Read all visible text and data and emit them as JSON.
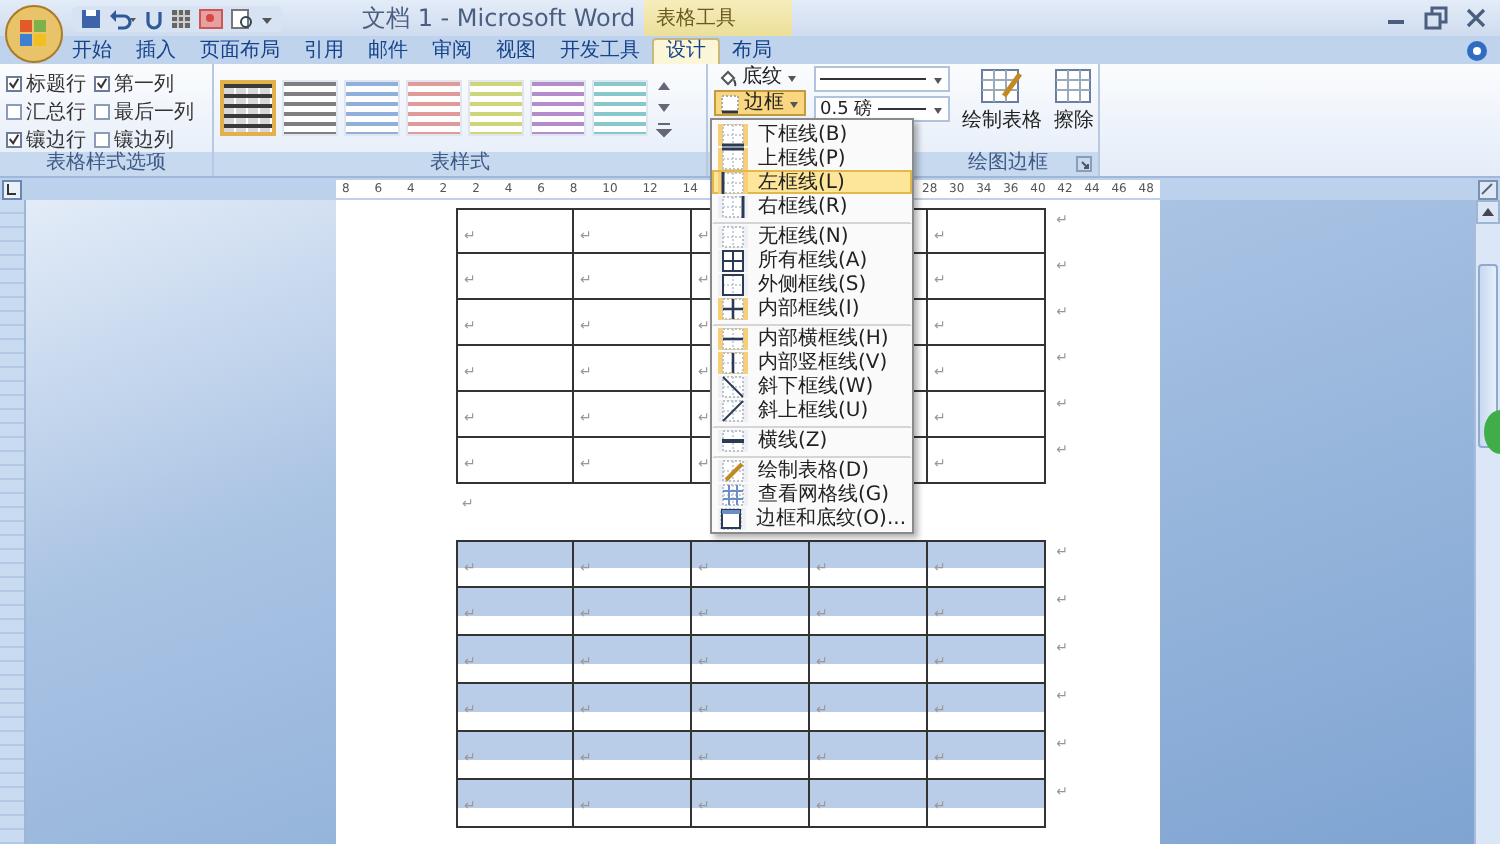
{
  "window": {
    "title": "文档 1 - Microsoft Word",
    "context_tab_group": "表格工具"
  },
  "tabs": [
    {
      "label": "开始",
      "selected": false
    },
    {
      "label": "插入",
      "selected": false
    },
    {
      "label": "页面布局",
      "selected": false
    },
    {
      "label": "引用",
      "selected": false
    },
    {
      "label": "邮件",
      "selected": false
    },
    {
      "label": "审阅",
      "selected": false
    },
    {
      "label": "视图",
      "selected": false
    },
    {
      "label": "开发工具",
      "selected": false
    },
    {
      "label": "设计",
      "selected": true
    },
    {
      "label": "布局",
      "selected": false
    }
  ],
  "style_options": {
    "label": "表格样式选项",
    "options": [
      {
        "label": "标题行",
        "checked": true
      },
      {
        "label": "第一列",
        "checked": true
      },
      {
        "label": "汇总行",
        "checked": false
      },
      {
        "label": "最后一列",
        "checked": false
      },
      {
        "label": "镶边行",
        "checked": true
      },
      {
        "label": "镶边列",
        "checked": false
      }
    ]
  },
  "table_styles": {
    "label": "表样式",
    "styles": [
      {
        "color": "#3a3a3a",
        "selected": true
      },
      {
        "color": "#7f7f7f",
        "selected": false
      },
      {
        "color": "#8fb0dc",
        "selected": false
      },
      {
        "color": "#e09a9a",
        "selected": false
      },
      {
        "color": "#cfd67a",
        "selected": false
      },
      {
        "color": "#b48ccb",
        "selected": false
      },
      {
        "color": "#86c8cc",
        "selected": false
      }
    ]
  },
  "draw_borders": {
    "label": "绘图边框",
    "shading": "底纹",
    "borders": "边框",
    "borders_pressed": true,
    "weight": "0.5 磅",
    "draw_table": "绘制表格",
    "eraser": "擦除"
  },
  "ruler": [
    [
      "8",
      "6",
      "4",
      "2",
      "2",
      "4",
      "6",
      "8",
      "10",
      "12",
      "14"
    ],
    [
      "28",
      "30",
      "34",
      "36",
      "40",
      "42",
      "44",
      "46",
      "48"
    ]
  ],
  "border_menu": [
    {
      "label": "下框线(B)",
      "checked": true,
      "selected": false,
      "divider_after": false
    },
    {
      "label": "上框线(P)",
      "checked": true,
      "selected": false,
      "divider_after": false
    },
    {
      "label": "左框线(L)",
      "checked": true,
      "selected": true,
      "divider_after": false
    },
    {
      "label": "右框线(R)",
      "checked": false,
      "selected": false,
      "divider_after": true
    },
    {
      "label": "无框线(N)",
      "checked": false,
      "selected": false,
      "divider_after": false
    },
    {
      "label": "所有框线(A)",
      "checked": false,
      "selected": false,
      "divider_after": false
    },
    {
      "label": "外侧框线(S)",
      "checked": false,
      "selected": false,
      "divider_after": false
    },
    {
      "label": "内部框线(I)",
      "checked": true,
      "selected": false,
      "divider_after": true
    },
    {
      "label": "内部横框线(H)",
      "checked": true,
      "selected": false,
      "divider_after": false
    },
    {
      "label": "内部竖框线(V)",
      "checked": true,
      "selected": false,
      "divider_after": false
    },
    {
      "label": "斜下框线(W)",
      "checked": false,
      "selected": false,
      "divider_after": false
    },
    {
      "label": "斜上框线(U)",
      "checked": false,
      "selected": false,
      "divider_after": true
    },
    {
      "label": "横线(Z)",
      "checked": false,
      "selected": false,
      "divider_after": true
    },
    {
      "label": "绘制表格(D)",
      "checked": false,
      "selected": false,
      "divider_after": false
    },
    {
      "label": "查看网格线(G)",
      "checked": false,
      "selected": false,
      "divider_after": false
    },
    {
      "label": "边框和底纹(O)...",
      "checked": false,
      "selected": false,
      "divider_after": false
    }
  ],
  "document": {
    "tables": [
      {
        "rows": [
          {
            "shaded": false,
            "cells": [
              "↵",
              "↵",
              "↵",
              null,
              "↵"
            ],
            "end": "↵"
          },
          {
            "shaded": false,
            "cells": [
              "↵",
              "↵",
              "↵",
              null,
              "↵"
            ],
            "end": "↵"
          },
          {
            "shaded": false,
            "cells": [
              "↵",
              "↵",
              "↵",
              null,
              "↵"
            ],
            "end": "↵"
          },
          {
            "shaded": false,
            "cells": [
              "↵",
              "↵",
              "↵",
              null,
              "↵"
            ],
            "end": "↵"
          },
          {
            "shaded": false,
            "cells": [
              "↵",
              "↵",
              "↵",
              null,
              "↵"
            ],
            "end": "↵"
          },
          {
            "shaded": false,
            "cells": [
              "↵",
              "↵",
              "↵",
              null,
              "↵"
            ],
            "end": "↵"
          }
        ]
      },
      {
        "rows": [
          {
            "shaded": true,
            "cells": [
              "↵",
              "↵",
              "↵",
              "↵",
              "↵"
            ],
            "end": "↵"
          },
          {
            "shaded": true,
            "cells": [
              "↵",
              "↵",
              "↵",
              "↵",
              "↵"
            ],
            "end": "↵"
          },
          {
            "shaded": true,
            "cells": [
              "↵",
              "↵",
              "↵",
              "↵",
              "↵"
            ],
            "end": "↵"
          },
          {
            "shaded": true,
            "cells": [
              "↵",
              "↵",
              "↵",
              "↵",
              "↵"
            ],
            "end": "↵"
          },
          {
            "shaded": true,
            "cells": [
              "↵",
              "↵",
              "↵",
              "↵",
              "↵"
            ],
            "end": "↵"
          },
          {
            "shaded": true,
            "cells": [
              "↵",
              "↵",
              "↵",
              "↵",
              "↵"
            ],
            "end": "↵"
          }
        ]
      }
    ],
    "paragraph_mark": "↵"
  }
}
